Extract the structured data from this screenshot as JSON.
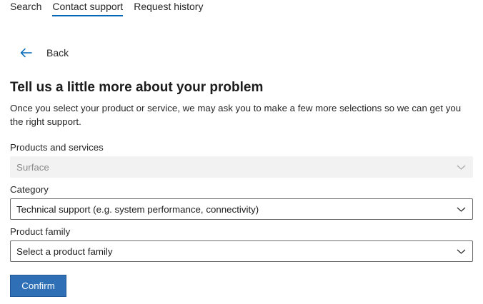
{
  "tabs": [
    {
      "label": "Search",
      "active": false
    },
    {
      "label": "Contact support",
      "active": true
    },
    {
      "label": "Request history",
      "active": false
    }
  ],
  "back": {
    "label": "Back"
  },
  "heading": "Tell us a little more about your problem",
  "description": "Once you select your product or service, we may ask you to make a few more selections so we can get you the right support.",
  "form": {
    "products": {
      "label": "Products and services",
      "value": "Surface",
      "disabled": true
    },
    "category": {
      "label": "Category",
      "value": "Technical support (e.g. system performance, connectivity)"
    },
    "product_family": {
      "label": "Product family",
      "value": "Select a product family"
    }
  },
  "confirm_label": "Confirm",
  "colors": {
    "accent": "#0067b8",
    "button": "#2f6fb5",
    "disabled_bg": "#f2f2f2"
  }
}
